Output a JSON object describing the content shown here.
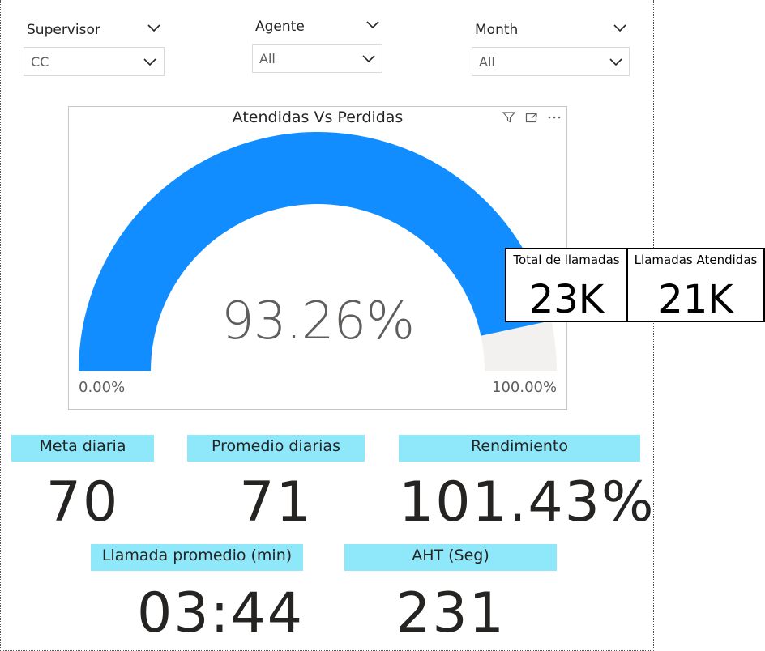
{
  "slicers": [
    {
      "title": "Supervisor",
      "value": "CC"
    },
    {
      "title": "Agente",
      "value": "All"
    },
    {
      "title": "Month",
      "value": "All"
    }
  ],
  "gauge": {
    "title": "Atendidas Vs Perdidas",
    "value_label": "93.26%",
    "fraction": 0.9326,
    "min_label": "0.00%",
    "max_label": "100.00%",
    "fill_color": "#118dff",
    "track_color": "#f2f1f0",
    "header_icons": [
      "filter-icon",
      "focus-mode-icon",
      "more-options-icon"
    ]
  },
  "cards": {
    "total": {
      "label": "Total de llamadas",
      "value": "23K"
    },
    "atendidas": {
      "label": "Llamadas Atendidas",
      "value": "21K"
    }
  },
  "kpis": {
    "meta": {
      "label": "Meta diaria",
      "value": "70"
    },
    "promedio": {
      "label": "Promedio diarias",
      "value": "71"
    },
    "rendimiento": {
      "label": "Rendimiento",
      "value": "101.43%"
    },
    "llamada": {
      "label": "Llamada promedio (min)",
      "value": "03:44"
    },
    "aht": {
      "label": "AHT (Seg)",
      "value": "231"
    }
  },
  "colors": {
    "kpi_label_bg": "#8ee8fa"
  }
}
